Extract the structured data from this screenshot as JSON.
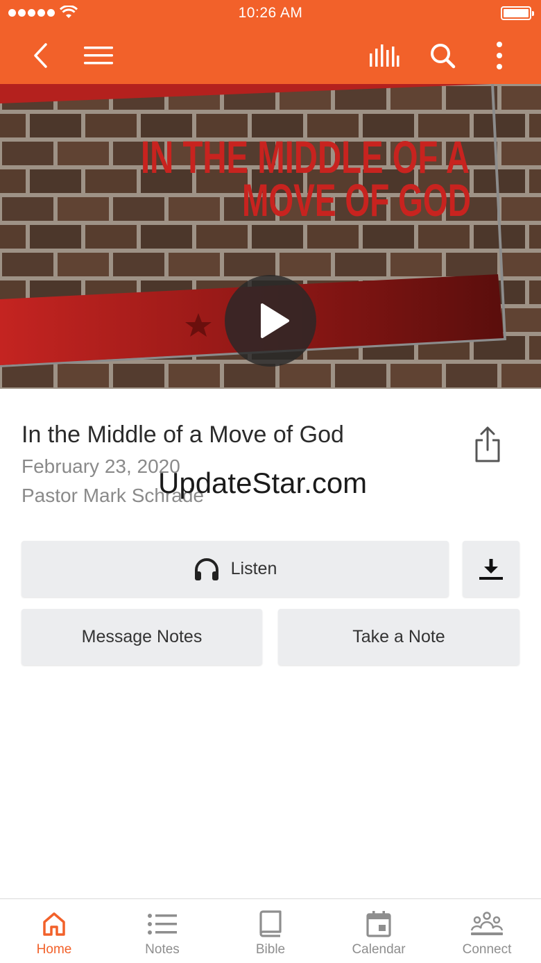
{
  "status_bar": {
    "time": "10:26 AM"
  },
  "nav": {
    "back_icon": "chevron-left-icon",
    "menu_icon": "hamburger-menu-icon",
    "audio_icon": "audio-levels-icon",
    "search_icon": "search-icon",
    "more_icon": "vertical-dots-icon"
  },
  "hero": {
    "artwork_title_line1": "IN THE MIDDLE OF A",
    "artwork_title_line2": "MOVE OF GOD",
    "play_icon": "play-icon"
  },
  "sermon": {
    "title": "In the Middle of a Move of God",
    "date": "February 23, 2020",
    "speaker": "Pastor Mark Schrade",
    "share_icon": "share-icon"
  },
  "watermark": "UpdateStar.com",
  "actions": {
    "listen_label": "Listen",
    "listen_icon": "headphones-icon",
    "download_icon": "download-icon",
    "message_notes_label": "Message Notes",
    "take_note_label": "Take a Note"
  },
  "tabs": [
    {
      "label": "Home",
      "icon": "home-icon",
      "active": true
    },
    {
      "label": "Notes",
      "icon": "list-icon",
      "active": false
    },
    {
      "label": "Bible",
      "icon": "book-icon",
      "active": false
    },
    {
      "label": "Calendar",
      "icon": "calendar-icon",
      "active": false
    },
    {
      "label": "Connect",
      "icon": "people-icon",
      "active": false
    }
  ],
  "colors": {
    "accent": "#F2612A",
    "button_bg": "#ECEDEF",
    "hero_red": "#B8211F"
  }
}
